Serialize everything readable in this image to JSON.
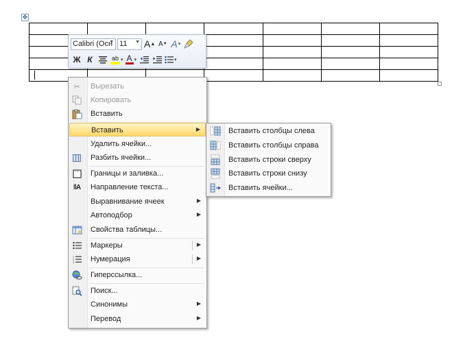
{
  "table": {
    "rows": 5,
    "cols": 7
  },
  "mini_toolbar": {
    "font_name": "Calibri (Осн",
    "font_size": "11",
    "grow_font": "A",
    "shrink_font": "A",
    "styles": "A",
    "bold": "Ж",
    "italic": "К",
    "font_color": "A",
    "highlight": "ab"
  },
  "context_menu": {
    "items": [
      {
        "label": "Вырезать",
        "icon": "scissors-icon",
        "disabled": true
      },
      {
        "label": "Копировать",
        "icon": "copy-icon",
        "disabled": true
      },
      {
        "label": "Вставить",
        "icon": "paste-icon",
        "disabled": false
      },
      {
        "label": "Вставить",
        "icon": "",
        "submenu": true,
        "highlight": true
      },
      {
        "label": "Удалить ячейки...",
        "icon": ""
      },
      {
        "label": "Разбить ячейки...",
        "icon": "split-cells-icon"
      },
      {
        "label": "Границы и заливка...",
        "icon": "borders-icon"
      },
      {
        "label": "Направление текста...",
        "icon": "text-direction-icon"
      },
      {
        "label": "Выравнивание ячеек",
        "icon": "",
        "submenu": true
      },
      {
        "label": "Автоподбор",
        "icon": "",
        "submenu": true
      },
      {
        "label": "Свойства таблицы...",
        "icon": "table-properties-icon"
      },
      {
        "label": "Маркеры",
        "icon": "bullets-icon",
        "submenu": true,
        "split": true
      },
      {
        "label": "Нумерация",
        "icon": "numbering-icon",
        "submenu": true,
        "split": true
      },
      {
        "label": "Гиперссылка...",
        "icon": "hyperlink-icon"
      },
      {
        "label": "Поиск...",
        "icon": "research-icon"
      },
      {
        "label": "Синонимы",
        "icon": "",
        "submenu": true
      },
      {
        "label": "Перевод",
        "icon": "",
        "submenu": true
      }
    ]
  },
  "insert_submenu": {
    "items": [
      {
        "label": "Вставить столбцы слева",
        "icon": "insert-columns-left-icon"
      },
      {
        "label": "Вставить столбцы справа",
        "icon": "insert-columns-right-icon"
      },
      {
        "label": "Вставить строки сверху",
        "icon": "insert-rows-above-icon"
      },
      {
        "label": "Вставить строки снизу",
        "icon": "insert-rows-below-icon"
      },
      {
        "label": "Вставить ячейки...",
        "icon": "insert-cells-icon"
      }
    ]
  },
  "colors": {
    "highlight_bg": "#ffd869",
    "font_color": "#c00000",
    "highlight_color": "#ffff00"
  }
}
